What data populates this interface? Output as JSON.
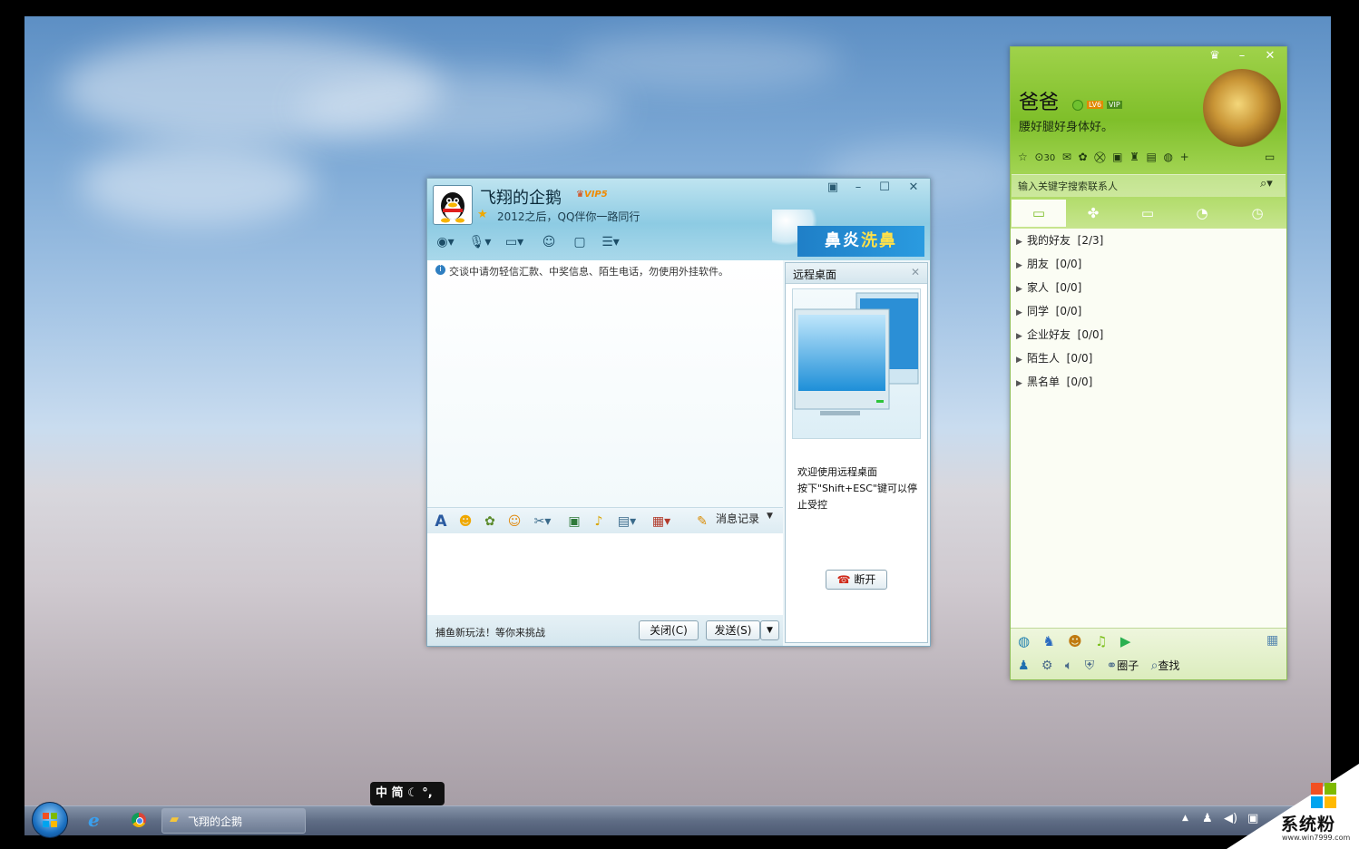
{
  "chat": {
    "contact_name": "飞翔的企鹅",
    "vip_badge": "VIP5",
    "signature": "2012之后，QQ伴你一路同行",
    "ad_part1": "鼻炎",
    "ad_part2": "洗鼻",
    "security_notice": "交谈中请勿轻信汇款、中奖信息、陌生电话，勿使用外挂软件。",
    "history_label": "消息记录",
    "game_promo": "捕鱼新玩法！等你来挑战",
    "close_button": "关闭(C)",
    "send_button": "发送(S)"
  },
  "remote": {
    "title": "远程桌面",
    "message_line1": "欢迎使用远程桌面",
    "message_line2": "按下\"Shift+ESC\"键可以停",
    "message_line3": "止受控",
    "disconnect_button": "断开"
  },
  "qq": {
    "nickname": "爸爸",
    "level_badge": "LV6",
    "vip_badge": "VIP",
    "mood": "腰好腿好身体好。",
    "counter": "30",
    "search_placeholder": "输入关键字搜索联系人",
    "groups": [
      {
        "name": "我的好友",
        "count": "[2/3]"
      },
      {
        "name": "朋友",
        "count": "[0/0]"
      },
      {
        "name": "家人",
        "count": "[0/0]"
      },
      {
        "name": "同学",
        "count": "[0/0]"
      },
      {
        "name": "企业好友",
        "count": "[0/0]"
      },
      {
        "name": "陌生人",
        "count": "[0/0]"
      },
      {
        "name": "黑名单",
        "count": "[0/0]"
      }
    ],
    "bottom_circle": "圈子",
    "bottom_find": "查找"
  },
  "ime": {
    "lang": "中",
    "mode": "简"
  },
  "taskbar": {
    "active_task": "飞翔的企鹅"
  },
  "watermark": {
    "brand": "系统粉",
    "url": "www.win7999.com"
  },
  "colors": {
    "qq_green": "#7fbf2a",
    "chat_blue": "#8dcbe3",
    "vip_orange": "#f08a00"
  }
}
